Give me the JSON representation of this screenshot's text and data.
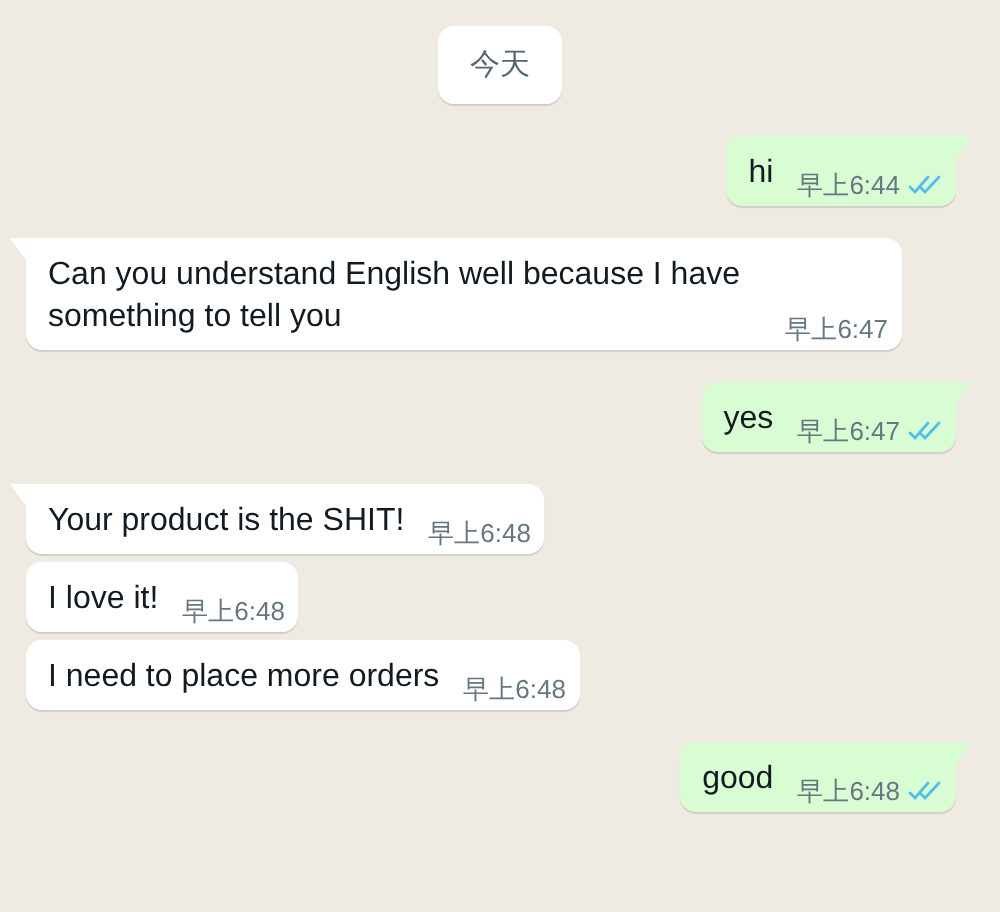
{
  "date_chip": "今天",
  "messages": [
    {
      "kind": "outgoing",
      "tail": true,
      "text": "hi",
      "time": "早上6:44",
      "read": true
    },
    {
      "kind": "incoming",
      "tail": true,
      "text": "Can you understand English well because I have something to tell you",
      "time": "早上6:47"
    },
    {
      "kind": "outgoing",
      "tail": true,
      "text": "yes",
      "time": "早上6:47",
      "read": true
    },
    {
      "kind": "incoming",
      "tail": true,
      "text": "Your product is the SHIT!",
      "time": "早上6:48"
    },
    {
      "kind": "incoming",
      "tail": false,
      "text": "I love it!",
      "time": "早上6:48"
    },
    {
      "kind": "incoming",
      "tail": false,
      "text": "I need to place more orders",
      "time": "早上6:48"
    },
    {
      "kind": "outgoing",
      "tail": true,
      "text": "good",
      "time": "早上6:48",
      "read": true
    }
  ]
}
